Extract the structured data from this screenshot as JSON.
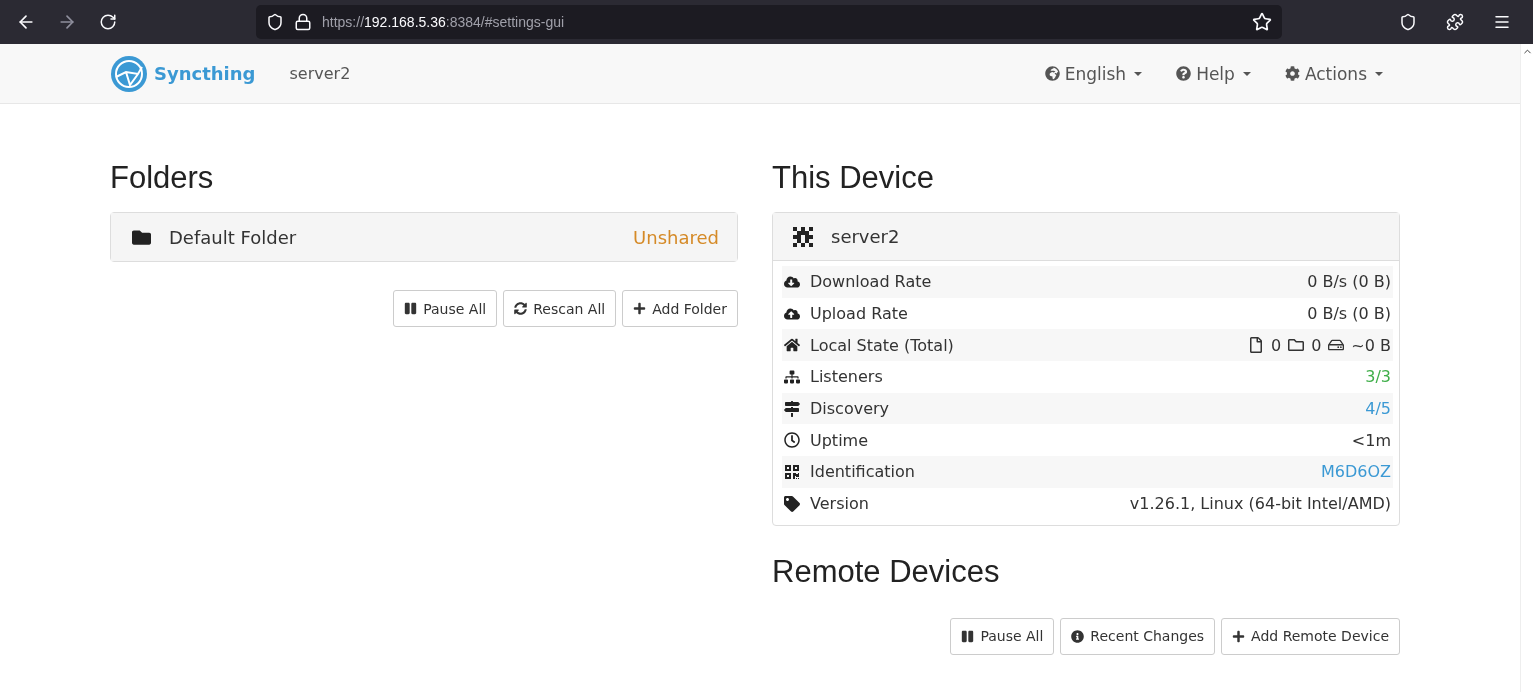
{
  "browser": {
    "url": {
      "scheme": "https://",
      "host": "192.168.5.36",
      "rest": ":8384/#settings-gui"
    }
  },
  "navbar": {
    "brand": "Syncthing",
    "device_name": "server2",
    "menus": [
      "English",
      "Help",
      "Actions"
    ]
  },
  "folders": {
    "heading": "Folders",
    "items": [
      {
        "name": "Default Folder",
        "status": "Unshared"
      }
    ],
    "buttons": [
      "Pause All",
      "Rescan All",
      "Add Folder"
    ]
  },
  "this_device": {
    "heading": "This Device",
    "name": "server2",
    "stats": [
      {
        "kind": "text",
        "label": "Download Rate",
        "value": "0 B/s (0 B)"
      },
      {
        "kind": "text",
        "label": "Upload Rate",
        "value": "0 B/s (0 B)"
      },
      {
        "kind": "counts",
        "label": "Local State (Total)",
        "files": "0",
        "directories": "0",
        "size": "~0 B"
      },
      {
        "kind": "colored",
        "label": "Listeners",
        "value": "3/3",
        "color": "#3fae49"
      },
      {
        "kind": "colored",
        "label": "Discovery",
        "value": "4/5",
        "color": "#3b99d4"
      },
      {
        "kind": "text",
        "label": "Uptime",
        "value": "<1m"
      },
      {
        "kind": "colored",
        "label": "Identification",
        "value": "M6D6OZ",
        "color": "#3b99d4"
      },
      {
        "kind": "text",
        "label": "Version",
        "value": "v1.26.1, Linux (64-bit Intel/AMD)"
      }
    ]
  },
  "remote_devices": {
    "heading": "Remote Devices",
    "buttons": [
      "Pause All",
      "Recent Changes",
      "Add Remote Device"
    ]
  }
}
